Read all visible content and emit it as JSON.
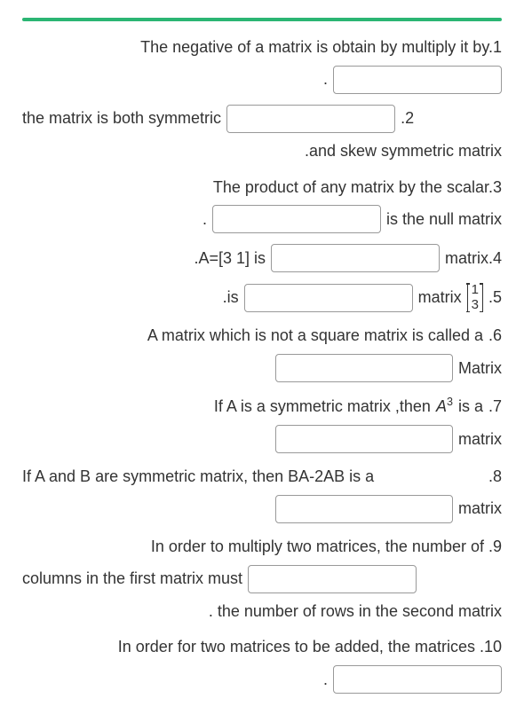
{
  "questions": {
    "q1": {
      "text": "The negative of a matrix is obtain by multiply it by.1"
    },
    "q2": {
      "part1": "the matrix is both symmetric",
      "number": ".2",
      "part2": ".and skew symmetric  matrix"
    },
    "q3": {
      "text": "The product of any matrix by the scalar.3",
      "suffix": "is the null matrix",
      "dot": "."
    },
    "q4": {
      "prefix": ".A=[3   1] is",
      "suffix": "matrix.4"
    },
    "q5": {
      "prefix": ".is",
      "mid": "matrix",
      "m_top": "1",
      "m_bot": "3",
      "number": ".5"
    },
    "q6": {
      "text": "A matrix which is not a square matrix is called a",
      "number": ".6",
      "suffix": "Matrix"
    },
    "q7": {
      "prefix": "If A is a symmetric  matrix ,then",
      "var": "A",
      "exp": "3",
      "mid": "is a",
      "number": ".7",
      "suffix": "matrix"
    },
    "q8": {
      "text": "If A and B are symmetric  matrix, then   BA-2AB is a",
      "number": ".8",
      "suffix": "matrix"
    },
    "q9": {
      "text": "In order to multiply two matrices, the number of .9",
      "part2": "columns in the first matrix must",
      "part3": ". the number of rows in the second matrix"
    },
    "q10": {
      "text": "In order for two matrices to be added, the matrices .10",
      "dot": "."
    }
  }
}
